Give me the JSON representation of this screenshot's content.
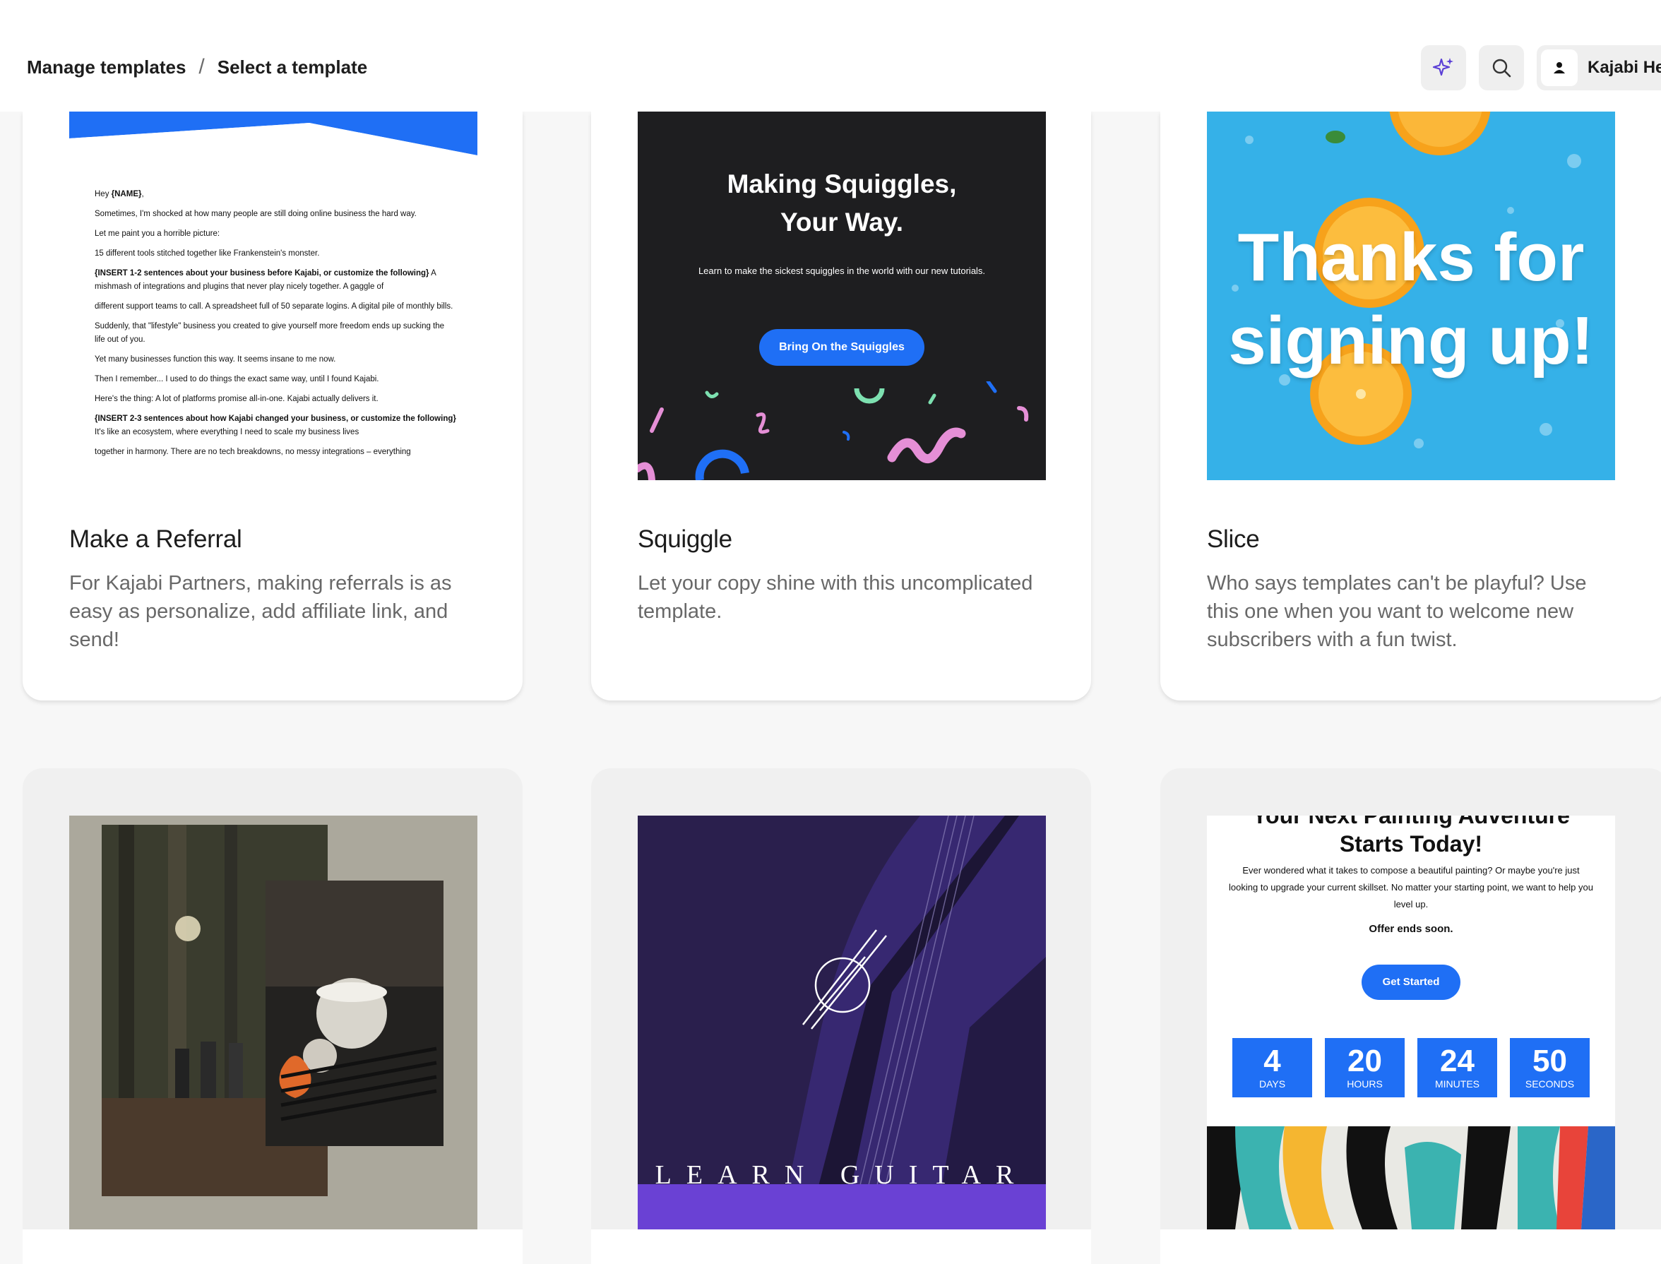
{
  "header": {
    "breadcrumb": {
      "root": "Manage templates",
      "separator": "/",
      "current": "Select a template"
    },
    "account_label": "Kajabi Hel"
  },
  "icons": {
    "ai": "sparkles-icon",
    "search": "search-icon",
    "user": "user-icon"
  },
  "colors": {
    "accent_blue": "#1f6ff5",
    "ai_purple": "#6a41d4",
    "page_bg": "#f7f7f7",
    "card_bg": "#ffffff"
  },
  "templates": [
    {
      "title": "Make a Referral",
      "description": "For Kajabi Partners, making referrals is as easy as personalize, add affiliate link, and send!",
      "preview": {
        "greeting_prefix": "Hey ",
        "greeting_name": "{NAME}",
        "greeting_suffix": ",",
        "lines": [
          "Sometimes, I'm shocked at how many people are still doing online business the hard way.",
          "Let me paint you a horrible picture:",
          "15 different tools stitched together like Frankenstein's monster."
        ],
        "insert1_bold": "{INSERT 1-2 sentences about your business before Kajabi, or customize the following}",
        "insert1_rest": " A mishmash of integrations and plugins that never play nicely together. A gaggle of",
        "lines2": [
          "different support teams to call. A spreadsheet full of 50 separate logins. A digital pile of monthly bills.",
          "Suddenly, that \"lifestyle\" business you created to give yourself more freedom ends up sucking the life out of you.",
          "Yet many businesses function this way. It seems insane to me now.",
          "Then I remember... I used to do things the exact same way, until I found Kajabi.",
          "Here's the thing: A lot of platforms promise all-in-one. Kajabi actually delivers it."
        ],
        "insert2_bold": "{INSERT 2-3 sentences about how Kajabi changed your business, or customize the following}",
        "insert2_rest": " It's like an ecosystem, where everything I need to scale my business lives",
        "last_line": "together in harmony. There are no tech breakdowns, no messy integrations – everything"
      }
    },
    {
      "title": "Squiggle",
      "description": "Let your copy shine with this uncomplicated template.",
      "preview": {
        "heading_line1": "Making Squiggles,",
        "heading_line2": "Your Way.",
        "subtext": "Learn to make the sickest squiggles in the world with our new tutorials.",
        "button": "Bring On the Squiggles"
      }
    },
    {
      "title": "Slice",
      "description": "Who says templates can't be playful? Use this one when you want to welcome new subscribers with a fun twist.",
      "preview": {
        "heading_line1": "Thanks for",
        "heading_line2": "signing up!"
      }
    },
    {
      "title": "",
      "description": "",
      "preview": {}
    },
    {
      "title": "",
      "description": "",
      "preview": {
        "banner": "LEARN GUITAR"
      }
    },
    {
      "title": "",
      "description": "",
      "preview": {
        "heading_line1": "Your Next Painting Adventure",
        "heading_line2": "Starts Today!",
        "body": "Ever wondered what it takes to compose a beautiful painting? Or maybe you're just looking to upgrade your current skillset. No matter your starting point, we want to help you level up.",
        "offer": "Offer ends soon.",
        "button": "Get Started",
        "countdown": [
          {
            "value": "4",
            "unit": "DAYS"
          },
          {
            "value": "20",
            "unit": "HOURS"
          },
          {
            "value": "24",
            "unit": "MINUTES"
          },
          {
            "value": "50",
            "unit": "SECONDS"
          }
        ]
      }
    }
  ]
}
